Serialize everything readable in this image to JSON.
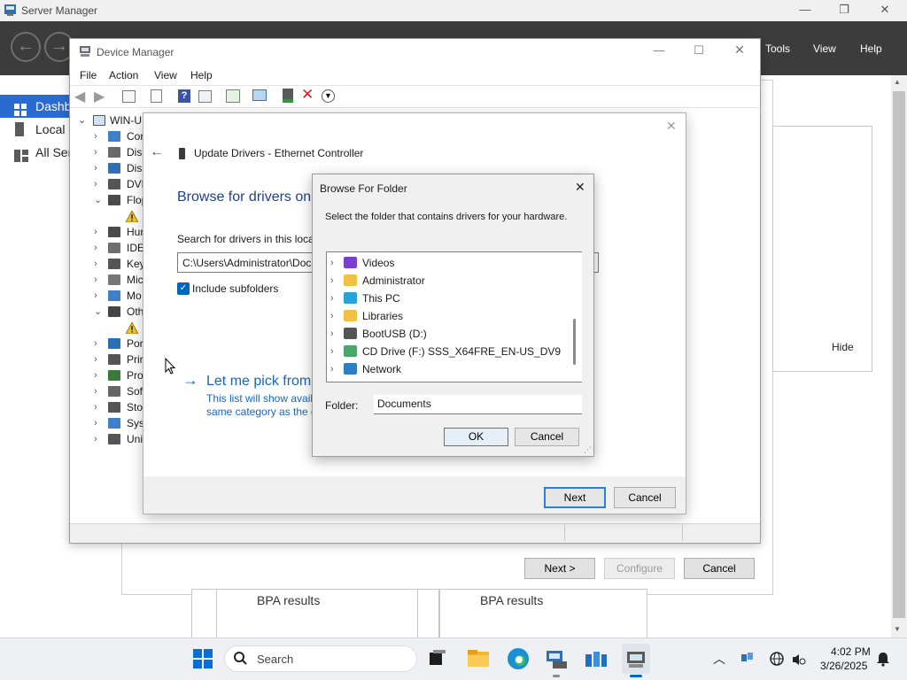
{
  "server_manager": {
    "title": "Server Manager",
    "menu": [
      "Tools",
      "View",
      "Help"
    ],
    "sidebar": [
      {
        "label": "Dashboard",
        "active": true
      },
      {
        "label": "Local Server",
        "active": false
      },
      {
        "label": "All Servers",
        "active": false
      }
    ],
    "hide_label": "Hide",
    "buttons": {
      "next": "Next >",
      "configure": "Configure",
      "cancel": "Cancel"
    },
    "bpa_1": "BPA results",
    "bpa_2": "BPA results"
  },
  "device_manager": {
    "title": "Device Manager",
    "menu": [
      "File",
      "Action",
      "View",
      "Help"
    ],
    "tree": {
      "root": "WIN-U",
      "items": [
        {
          "label": "Cor",
          "expander": "›"
        },
        {
          "label": "Disk",
          "expander": "›"
        },
        {
          "label": "Disp",
          "expander": "›"
        },
        {
          "label": "DVD",
          "expander": "›"
        },
        {
          "label": "Flop",
          "expander": "⌄"
        },
        {
          "label": "",
          "expander": ""
        },
        {
          "label": "Hur",
          "expander": "›"
        },
        {
          "label": "IDE",
          "expander": "›"
        },
        {
          "label": "Key",
          "expander": "›"
        },
        {
          "label": "Mic",
          "expander": "›"
        },
        {
          "label": "Mo",
          "expander": "›"
        },
        {
          "label": "Oth",
          "expander": "⌄"
        },
        {
          "label": "",
          "expander": ""
        },
        {
          "label": "Por",
          "expander": "›"
        },
        {
          "label": "Prir",
          "expander": "›"
        },
        {
          "label": "Pro",
          "expander": "›"
        },
        {
          "label": "Soft",
          "expander": "›"
        },
        {
          "label": "Stor",
          "expander": "›"
        },
        {
          "label": "Syst",
          "expander": "›"
        },
        {
          "label": "Uni",
          "expander": "›"
        }
      ]
    }
  },
  "wizard": {
    "title": "Update Drivers - Ethernet Controller",
    "heading": "Browse for drivers on",
    "search_label": "Search for drivers in this locat",
    "path_value": "C:\\Users\\Administrator\\Doc",
    "include_subfolders": "Include subfolders",
    "pick_link": "Let me pick from",
    "pick_desc_1": "This list will show avail",
    "pick_desc_2": "same category as the d",
    "next": "Next",
    "cancel": "Cancel"
  },
  "browse_folder": {
    "title": "Browse For Folder",
    "instruction": "Select the folder that contains drivers for your hardware.",
    "items": [
      {
        "label": "Videos",
        "icon": "videos-folder-icon",
        "color": "#7a3fd0"
      },
      {
        "label": "Administrator",
        "icon": "user-folder-icon",
        "color": "#f0c244"
      },
      {
        "label": "This PC",
        "icon": "pc-icon",
        "color": "#27a3d8"
      },
      {
        "label": "Libraries",
        "icon": "libraries-icon",
        "color": "#f0c244"
      },
      {
        "label": "BootUSB (D:)",
        "icon": "usb-drive-icon",
        "color": "#555555"
      },
      {
        "label": "CD Drive (F:) SSS_X64FRE_EN-US_DV9",
        "icon": "cd-drive-icon",
        "color": "#4aa56a"
      },
      {
        "label": "Network",
        "icon": "network-icon",
        "color": "#2d7fc1"
      }
    ],
    "folder_label": "Folder:",
    "folder_value": "Documents",
    "ok": "OK",
    "cancel": "Cancel"
  },
  "taskbar": {
    "search_placeholder": "Search",
    "time": "4:02 PM",
    "date": "3/26/2025"
  },
  "colors": {
    "accent": "#0067c0",
    "sm_header": "#3c3c3c",
    "link_blue": "#1565c0",
    "error_red": "#d32020"
  }
}
